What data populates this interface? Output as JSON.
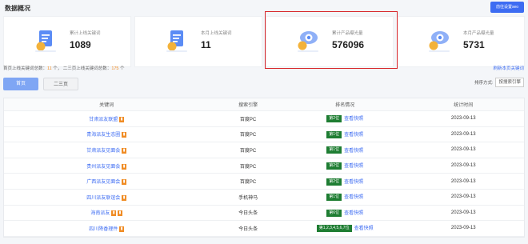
{
  "header": {
    "title": "数据概况",
    "top_button": "前往设置seo"
  },
  "stats": [
    {
      "label": "累计上线关键词",
      "value": "1089",
      "icon": "document-coin-icon"
    },
    {
      "label": "本月上线关键词",
      "value": "11",
      "icon": "document-coin-icon"
    },
    {
      "label": "累计产品曝光量",
      "value": "576096",
      "icon": "eye-coin-icon"
    },
    {
      "label": "本月产品曝光量",
      "value": "5731",
      "icon": "eye-coin-icon"
    }
  ],
  "info": {
    "prefix1": "首页上线关键词总数：",
    "count1": "11",
    "unit1": " 个，",
    "prefix2": "二三页上线关键词总数：",
    "count2": "175",
    "unit2": " 个"
  },
  "refresh_link": "刷新本页关键词",
  "tabs": [
    "首页",
    "二三页"
  ],
  "sort": {
    "label": "排序方式:",
    "value": "按搜索引擎"
  },
  "table": {
    "headers": [
      "关键词",
      "搜索引擎",
      "排名情况",
      "统计时间"
    ],
    "rows": [
      {
        "keyword": "甘肃派友联盟",
        "engine": "百度PC",
        "rank": "第2位",
        "snapshot": "查看快照",
        "date": "2023-09-13"
      },
      {
        "keyword": "青海派友生态圈",
        "engine": "百度PC",
        "rank": "第1位",
        "snapshot": "查看快照",
        "date": "2023-09-13"
      },
      {
        "keyword": "甘肃派友见面会",
        "engine": "百度PC",
        "rank": "第1位",
        "snapshot": "查看快照",
        "date": "2023-09-13"
      },
      {
        "keyword": "贵州派友见面会",
        "engine": "百度PC",
        "rank": "第2位",
        "snapshot": "查看快照",
        "date": "2023-09-13"
      },
      {
        "keyword": "广西派友见面会",
        "engine": "百度PC",
        "rank": "第2位",
        "snapshot": "查看快照",
        "date": "2023-09-13"
      },
      {
        "keyword": "四川派友联谊会",
        "engine": "手机神马",
        "rank": "第1位",
        "snapshot": "查看快照",
        "date": "2023-09-13"
      },
      {
        "keyword": "海南派友",
        "engine": "今日头条",
        "rank": "第6位",
        "snapshot": "查看快照",
        "date": "2023-09-13"
      },
      {
        "keyword": "四川降香理件",
        "engine": "今日头条",
        "rank": "第1,2,3,4,5,6,7位",
        "snapshot": "查看快照",
        "date": "2023-09-13"
      }
    ]
  },
  "colors": {
    "accent": "#3d6cf2",
    "highlight_border": "#d7262b",
    "rank_badge": "#1e7d32",
    "tag": "#f08c24"
  }
}
